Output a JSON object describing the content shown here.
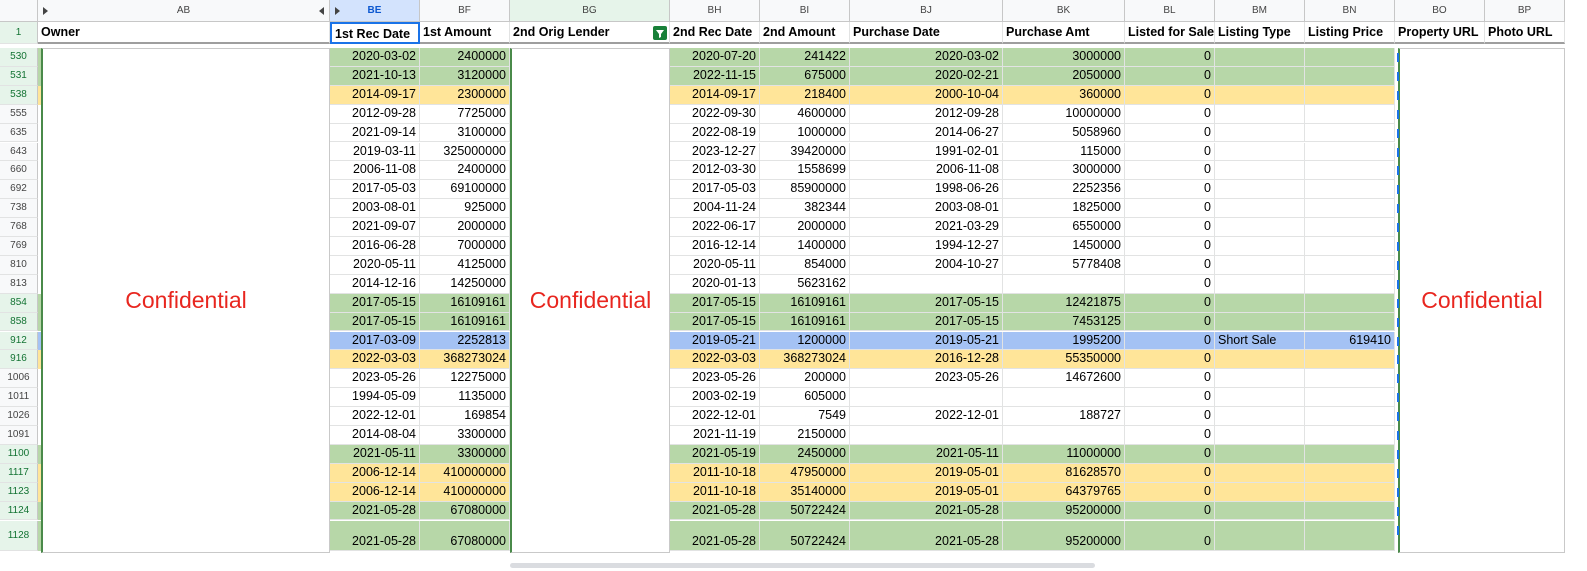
{
  "columns": [
    {
      "letter": "AB",
      "header": "Owner"
    },
    {
      "letter": "BE",
      "header": "1st Rec Date"
    },
    {
      "letter": "BF",
      "header": "1st Amount"
    },
    {
      "letter": "BG",
      "header": "2nd Orig Lender"
    },
    {
      "letter": "BH",
      "header": "2nd Rec Date"
    },
    {
      "letter": "BI",
      "header": "2nd Amount"
    },
    {
      "letter": "BJ",
      "header": "Purchase Date"
    },
    {
      "letter": "BK",
      "header": "Purchase Amt"
    },
    {
      "letter": "BL",
      "header": "Listed for Sale?"
    },
    {
      "letter": "BM",
      "header": "Listing Type"
    },
    {
      "letter": "BN",
      "header": "Listing Price"
    },
    {
      "letter": "BO",
      "header": "Property URL"
    },
    {
      "letter": "BP",
      "header": "Photo URL"
    }
  ],
  "header_row_number": "1",
  "confidential_label": "Confidential",
  "colors": {
    "green": "#b7d7a8",
    "yellow": "#ffe599",
    "blue": "#a4c2f4",
    "confidential": "#e8261f",
    "selected_col": "#0b57d0"
  },
  "icons": {
    "filter": "filter-icon",
    "expand": "expand-arrow-icon",
    "collapse": "collapse-arrow-icon"
  },
  "rows": [
    {
      "n": "530",
      "hl": "g",
      "BE": "2020-03-02",
      "BF": "2400000",
      "BH": "2020-07-20",
      "BI": "241422",
      "BJ": "2020-03-02",
      "BK": "3000000",
      "BL": "0",
      "BM": "",
      "BN": ""
    },
    {
      "n": "531",
      "hl": "g",
      "BE": "2021-10-13",
      "BF": "3120000",
      "BH": "2022-11-15",
      "BI": "675000",
      "BJ": "2020-02-21",
      "BK": "2050000",
      "BL": "0",
      "BM": "",
      "BN": ""
    },
    {
      "n": "538",
      "hl": "y",
      "BE": "2014-09-17",
      "BF": "2300000",
      "BH": "2014-09-17",
      "BI": "218400",
      "BJ": "2000-10-04",
      "BK": "360000",
      "BL": "0",
      "BM": "",
      "BN": ""
    },
    {
      "n": "555",
      "hl": "",
      "BE": "2012-09-28",
      "BF": "7725000",
      "BH": "2022-09-30",
      "BI": "4600000",
      "BJ": "2012-09-28",
      "BK": "10000000",
      "BL": "0",
      "BM": "",
      "BN": ""
    },
    {
      "n": "635",
      "hl": "",
      "BE": "2021-09-14",
      "BF": "3100000",
      "BH": "2022-08-19",
      "BI": "1000000",
      "BJ": "2014-06-27",
      "BK": "5058960",
      "BL": "0",
      "BM": "",
      "BN": ""
    },
    {
      "n": "643",
      "hl": "",
      "BE": "2019-03-11",
      "BF": "325000000",
      "BH": "2023-12-27",
      "BI": "39420000",
      "BJ": "1991-02-01",
      "BK": "115000",
      "BL": "0",
      "BM": "",
      "BN": ""
    },
    {
      "n": "660",
      "hl": "",
      "BE": "2006-11-08",
      "BF": "2400000",
      "BH": "2012-03-30",
      "BI": "1558699",
      "BJ": "2006-11-08",
      "BK": "3000000",
      "BL": "0",
      "BM": "",
      "BN": ""
    },
    {
      "n": "692",
      "hl": "",
      "BE": "2017-05-03",
      "BF": "69100000",
      "BH": "2017-05-03",
      "BI": "85900000",
      "BJ": "1998-06-26",
      "BK": "2252356",
      "BL": "0",
      "BM": "",
      "BN": ""
    },
    {
      "n": "738",
      "hl": "",
      "BE": "2003-08-01",
      "BF": "925000",
      "BH": "2004-11-24",
      "BI": "382344",
      "BJ": "2003-08-01",
      "BK": "1825000",
      "BL": "0",
      "BM": "",
      "BN": ""
    },
    {
      "n": "768",
      "hl": "",
      "BE": "2021-09-07",
      "BF": "2000000",
      "BH": "2022-06-17",
      "BI": "2000000",
      "BJ": "2021-03-29",
      "BK": "6550000",
      "BL": "0",
      "BM": "",
      "BN": ""
    },
    {
      "n": "769",
      "hl": "",
      "BE": "2016-06-28",
      "BF": "7000000",
      "BH": "2016-12-14",
      "BI": "1400000",
      "BJ": "1994-12-27",
      "BK": "1450000",
      "BL": "0",
      "BM": "",
      "BN": ""
    },
    {
      "n": "810",
      "hl": "",
      "BE": "2020-05-11",
      "BF": "4125000",
      "BH": "2020-05-11",
      "BI": "854000",
      "BJ": "2004-10-27",
      "BK": "5778408",
      "BL": "0",
      "BM": "",
      "BN": ""
    },
    {
      "n": "813",
      "hl": "",
      "BE": "2014-12-16",
      "BF": "14250000",
      "BH": "2020-01-13",
      "BI": "5623162",
      "BJ": "",
      "BK": "",
      "BL": "0",
      "BM": "",
      "BN": ""
    },
    {
      "n": "854",
      "hl": "g",
      "BE": "2017-05-15",
      "BF": "16109161",
      "BH": "2017-05-15",
      "BI": "16109161",
      "BJ": "2017-05-15",
      "BK": "12421875",
      "BL": "0",
      "BM": "",
      "BN": ""
    },
    {
      "n": "858",
      "hl": "g",
      "BE": "2017-05-15",
      "BF": "16109161",
      "BH": "2017-05-15",
      "BI": "16109161",
      "BJ": "2017-05-15",
      "BK": "7453125",
      "BL": "0",
      "BM": "",
      "BN": ""
    },
    {
      "n": "912",
      "hl": "b",
      "BE": "2017-03-09",
      "BF": "2252813",
      "BH": "2019-05-21",
      "BI": "1200000",
      "BJ": "2019-05-21",
      "BK": "1995200",
      "BL": "0",
      "BM": "Short Sale",
      "BN": "619410"
    },
    {
      "n": "916",
      "hl": "y",
      "BE": "2022-03-03",
      "BF": "368273024",
      "BH": "2022-03-03",
      "BI": "368273024",
      "BJ": "2016-12-28",
      "BK": "55350000",
      "BL": "0",
      "BM": "",
      "BN": ""
    },
    {
      "n": "1006",
      "hl": "",
      "BE": "2023-05-26",
      "BF": "12275000",
      "BH": "2023-05-26",
      "BI": "200000",
      "BJ": "2023-05-26",
      "BK": "14672600",
      "BL": "0",
      "BM": "",
      "BN": ""
    },
    {
      "n": "1011",
      "hl": "",
      "BE": "1994-05-09",
      "BF": "1135000",
      "BH": "2003-02-19",
      "BI": "605000",
      "BJ": "",
      "BK": "",
      "BL": "0",
      "BM": "",
      "BN": ""
    },
    {
      "n": "1026",
      "hl": "",
      "BE": "2022-12-01",
      "BF": "169854",
      "BH": "2022-12-01",
      "BI": "7549",
      "BJ": "2022-12-01",
      "BK": "188727",
      "BL": "0",
      "BM": "",
      "BN": ""
    },
    {
      "n": "1091",
      "hl": "",
      "BE": "2014-08-04",
      "BF": "3300000",
      "BH": "2021-11-19",
      "BI": "2150000",
      "BJ": "",
      "BK": "",
      "BL": "0",
      "BM": "",
      "BN": ""
    },
    {
      "n": "1100",
      "hl": "g",
      "BE": "2021-05-11",
      "BF": "3300000",
      "BH": "2021-05-19",
      "BI": "2450000",
      "BJ": "2021-05-11",
      "BK": "11000000",
      "BL": "0",
      "BM": "",
      "BN": ""
    },
    {
      "n": "1117",
      "hl": "y",
      "BE": "2006-12-14",
      "BF": "410000000",
      "BH": "2011-10-18",
      "BI": "47950000",
      "BJ": "2019-05-01",
      "BK": "81628570",
      "BL": "0",
      "BM": "",
      "BN": ""
    },
    {
      "n": "1123",
      "hl": "y",
      "BE": "2006-12-14",
      "BF": "410000000",
      "BH": "2011-10-18",
      "BI": "35140000",
      "BJ": "2019-05-01",
      "BK": "64379765",
      "BL": "0",
      "BM": "",
      "BN": ""
    },
    {
      "n": "1124",
      "hl": "g",
      "BE": "2021-05-28",
      "BF": "67080000",
      "BH": "2021-05-28",
      "BI": "50722424",
      "BJ": "2021-05-28",
      "BK": "95200000",
      "BL": "0",
      "BM": "",
      "BN": ""
    },
    {
      "n": "1128",
      "hl": "g",
      "BE": "2021-05-28",
      "BF": "67080000",
      "BH": "2021-05-28",
      "BI": "50722424",
      "BJ": "2021-05-28",
      "BK": "95200000",
      "BL": "0",
      "BM": "",
      "BN": ""
    }
  ]
}
